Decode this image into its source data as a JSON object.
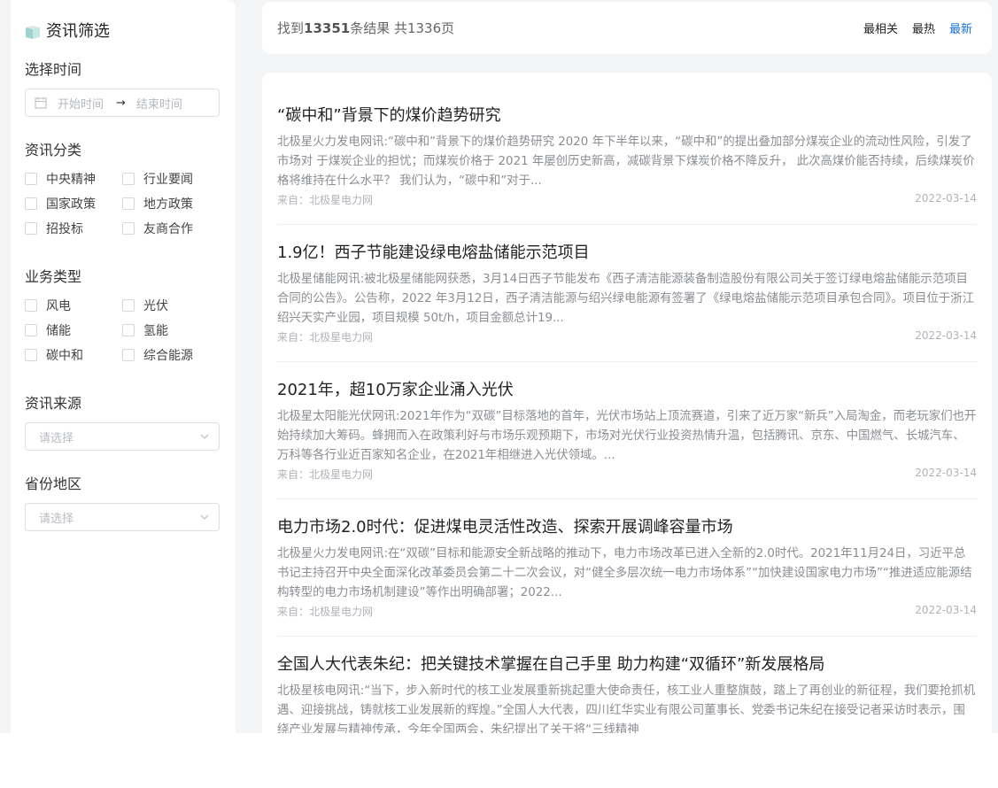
{
  "sidebar": {
    "title": "资讯筛选",
    "time": {
      "label": "选择时间",
      "start_placeholder": "开始时间",
      "end_placeholder": "结束时间"
    },
    "category": {
      "label": "资讯分类",
      "options": [
        "中央精神",
        "行业要闻",
        "国家政策",
        "地方政策",
        "招投标",
        "友商合作"
      ]
    },
    "business": {
      "label": "业务类型",
      "options": [
        "风电",
        "光伏",
        "储能",
        "氢能",
        "碳中和",
        "综合能源"
      ]
    },
    "source": {
      "label": "资讯来源",
      "placeholder": "请选择"
    },
    "region": {
      "label": "省份地区",
      "placeholder": "请选择"
    }
  },
  "results_bar": {
    "prefix": "找到",
    "count": "13351",
    "suffix": "条结果 共1336页",
    "sorts": [
      "最相关",
      "最热",
      "最新"
    ],
    "active_sort": "最新"
  },
  "articles": [
    {
      "title": "“碳中和”背景下的煤价趋势研究",
      "summary": "北极星火力发电网讯:“碳中和”背景下的煤价趋势研究 2020 年下半年以来，“碳中和”的提出叠加部分煤炭企业的流动性风险，引发了市场对 于煤炭企业的担忧；而煤炭价格于 2021 年屡创历史新高，减碳背景下煤炭价格不降反升， 此次高煤价能否持续，后续煤炭价格将维持在什么水平？ 我们认为，“碳中和”对于...",
      "source": "来自：北极星电力网",
      "date": "2022-03-14"
    },
    {
      "title": "1.9亿！西子节能建设绿电熔盐储能示范项目",
      "summary": "北极星储能网讯:被北极星储能网获悉，3月14日西子节能发布《西子清洁能源装备制造股份有限公司关于签订绿电熔盐储能示范项目合同的公告》。公告称，2022 年3月12日，西子清洁能源与绍兴绿电能源有签署了《绿电熔盐储能示范项目承包合同》。项目位于浙江绍兴天实产业园，项目规模 50t/h，项目金额总计19...",
      "source": "来自：北极星电力网",
      "date": "2022-03-14"
    },
    {
      "title": "2021年，超10万家企业涌入光伏",
      "summary": "北极星太阳能光伏网讯:2021年作为“双碳”目标落地的首年，光伏市场站上顶流赛道，引来了近万家“新兵”入局淘金，而老玩家们也开始持续加大筹码。蜂拥而入在政策利好与市场乐观预期下，市场对光伏行业投资热情升温，包括腾讯、京东、中国燃气、长城汽车、万科等各行业近百家知名企业，在2021年相继进入光伏领域。...",
      "source": "来自：北极星电力网",
      "date": "2022-03-14"
    },
    {
      "title": "电力市场2.0时代：促进煤电灵活性改造、探索开展调峰容量市场",
      "summary": "北极星火力发电网讯:在“双碳”目标和能源安全新战略的推动下，电力市场改革已进入全新的2.0时代。2021年11月24日，习近平总书记主持召开中央全面深化改革委员会第二十二次会议，对“健全多层次统一电力市场体系”“加快建设国家电力市场”“推进适应能源结构转型的电力市场机制建设”等作出明确部署；2022...",
      "source": "来自：北极星电力网",
      "date": "2022-03-14"
    },
    {
      "title": "全国人大代表朱纪：把关键技术掌握在自己手里 助力构建“双循环”新发展格局",
      "summary": "北极星核电网讯:“当下，步入新时代的核工业发展重新挑起重大使命责任，核工业人重整旗鼓，踏上了再创业的新征程，我们要抢抓机遇、迎接挑战，铸就核工业发展新的辉煌。”全国人大代表，四川红华实业有限公司董事长、党委书记朱纪在接受记者采访时表示，围绕产业发展与精神传承，今年全国两会，朱纪提出了关于将“三线精神",
      "source": "",
      "date": ""
    }
  ]
}
